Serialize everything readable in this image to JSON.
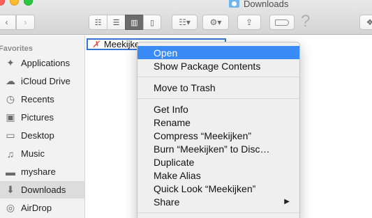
{
  "window": {
    "title": "Downloads"
  },
  "toolbar": {
    "view_buttons": [
      "icon-view",
      "list-view",
      "column-view",
      "coverflow-view"
    ],
    "active_view": "column-view",
    "help_glyph": "?"
  },
  "sidebar": {
    "heading": "Favorites",
    "items": [
      {
        "label": "Applications",
        "icon": "applications-icon"
      },
      {
        "label": "iCloud Drive",
        "icon": "cloud-icon"
      },
      {
        "label": "Recents",
        "icon": "clock-icon"
      },
      {
        "label": "Pictures",
        "icon": "camera-icon"
      },
      {
        "label": "Desktop",
        "icon": "desktop-icon"
      },
      {
        "label": "Music",
        "icon": "music-icon"
      },
      {
        "label": "myshare",
        "icon": "folder-icon"
      },
      {
        "label": "Downloads",
        "icon": "download-icon"
      },
      {
        "label": "AirDrop",
        "icon": "airdrop-icon"
      }
    ],
    "selected": "Downloads"
  },
  "file": {
    "name": "Meekijken"
  },
  "context_menu": {
    "groups": [
      [
        "Open",
        "Show Package Contents"
      ],
      [
        "Move to Trash"
      ],
      [
        "Get Info",
        "Rename",
        "Compress “Meekijken”",
        "Burn “Meekijken” to Disc…",
        "Duplicate",
        "Make Alias",
        "Quick Look “Meekijken”",
        "Share"
      ]
    ],
    "highlighted": "Open"
  },
  "colors": {
    "highlight": "#3a8bf6",
    "selection_border": "#3574d4",
    "close": "#fc5f57",
    "minimize": "#fdbc2e",
    "maximize": "#29c840"
  }
}
